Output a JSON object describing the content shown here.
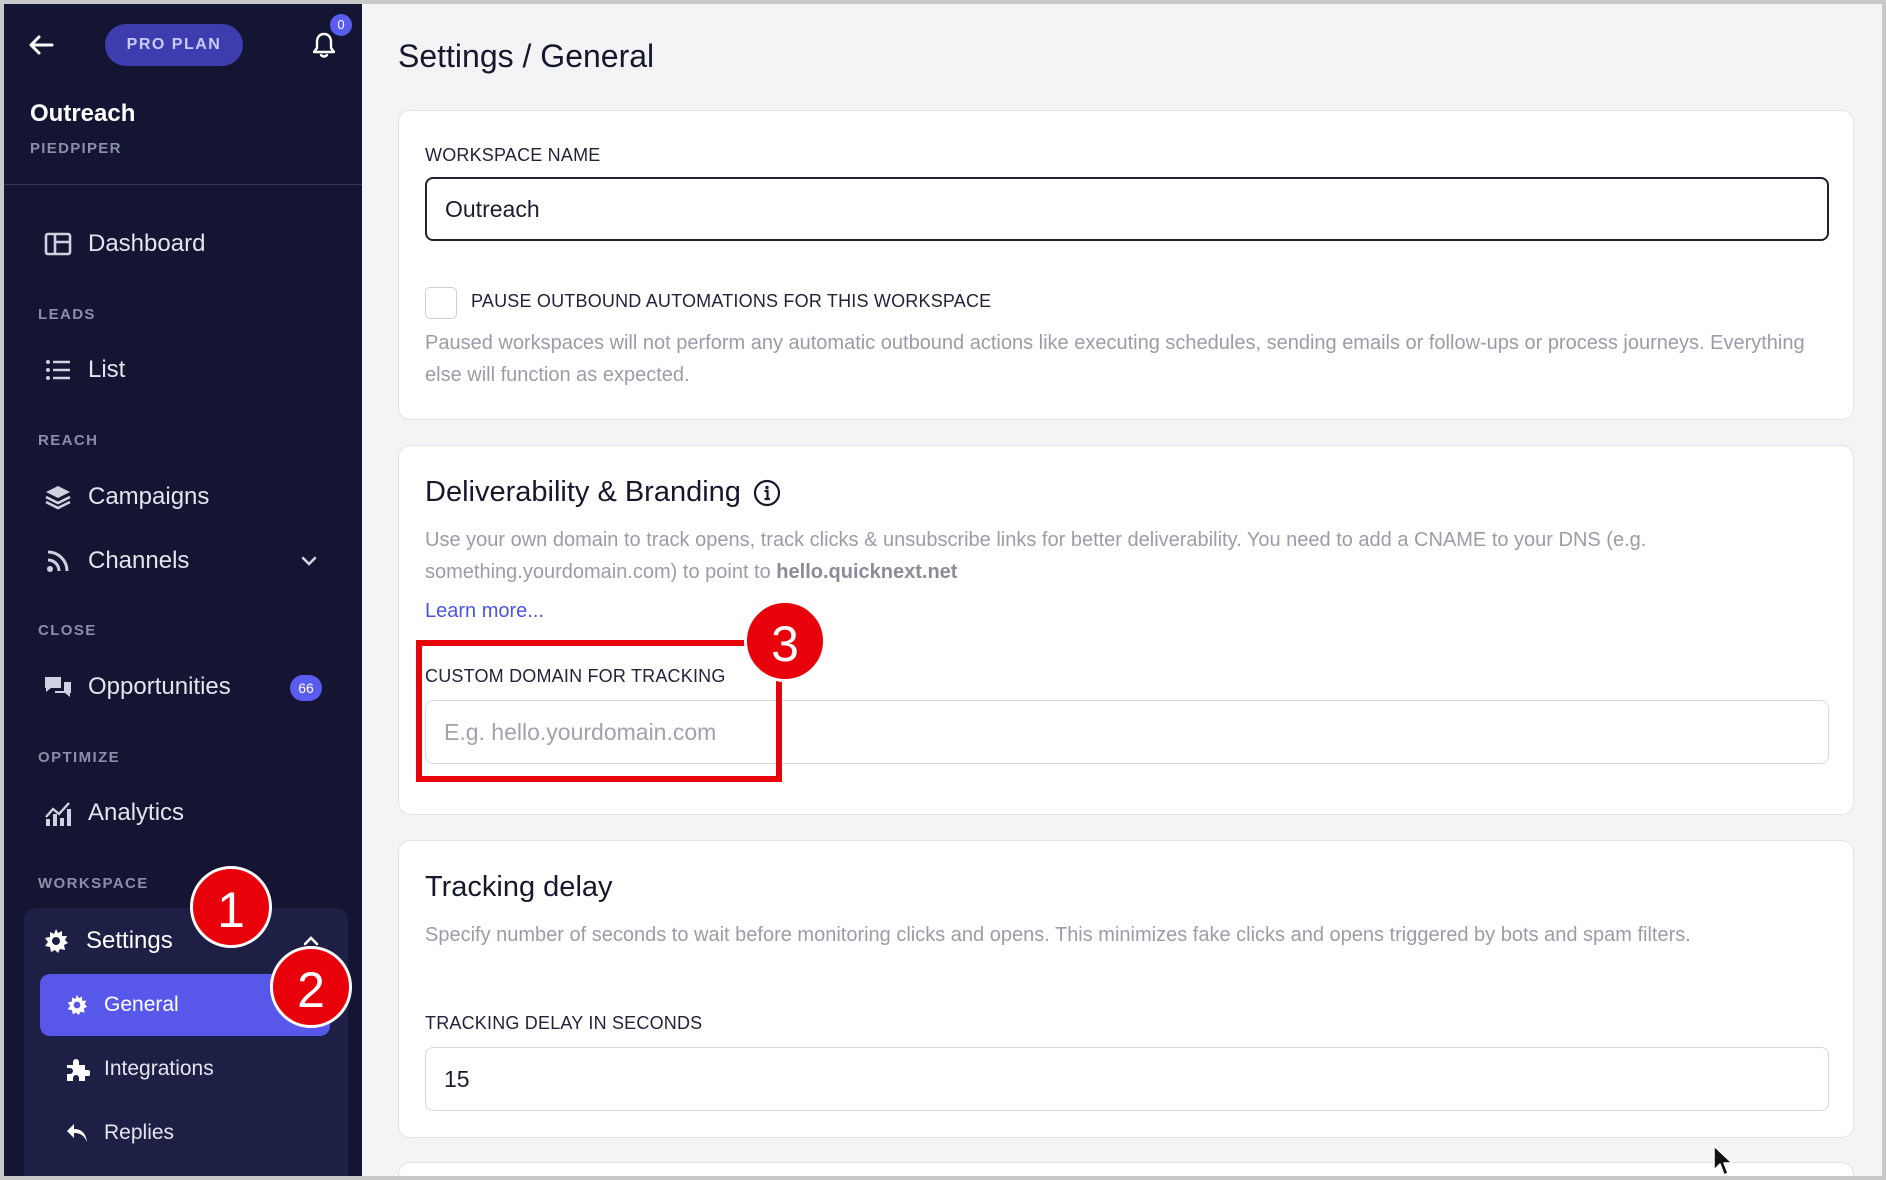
{
  "sidebar": {
    "plan_badge": "PRO PLAN",
    "notification_count": "0",
    "workspace_name": "Outreach",
    "workspace_org": "PIEDPIPER",
    "dashboard_label": "Dashboard",
    "sections": {
      "leads": "LEADS",
      "reach": "REACH",
      "close": "CLOSE",
      "optimize": "OPTIMIZE",
      "workspace": "WORKSPACE"
    },
    "list_label": "List",
    "campaigns_label": "Campaigns",
    "channels_label": "Channels",
    "opportunities_label": "Opportunities",
    "opportunities_count": "66",
    "analytics_label": "Analytics",
    "settings_label": "Settings",
    "settings_sub": {
      "general": "General",
      "integrations": "Integrations",
      "replies": "Replies"
    },
    "icons": {
      "back": "arrow-left-icon",
      "bell": "bell-icon",
      "dashboard": "dashboard-icon",
      "list": "list-icon",
      "campaigns": "layers-icon",
      "channels": "rss-icon",
      "opportunities": "chat-bubbles-icon",
      "analytics": "bar-chart-icon",
      "settings": "gear-icon",
      "integrations": "puzzle-icon",
      "replies": "reply-icon"
    }
  },
  "main": {
    "page_title": "Settings / General",
    "workspace_card": {
      "name_label": "WORKSPACE NAME",
      "name_value": "Outreach",
      "pause_label": "PAUSE OUTBOUND AUTOMATIONS FOR THIS WORKSPACE",
      "pause_checked": false,
      "pause_help": "Paused workspaces will not perform any automatic outbound actions like executing schedules, sending emails or follow-ups or process journeys. Everything else will function as expected."
    },
    "deliverability_card": {
      "title": "Deliverability & Branding",
      "help_prefix": "Use your own domain to track opens, track clicks & unsubscribe links for better deliverability. You need to add a CNAME to your DNS (e.g. something.yourdomain.com) to point to ",
      "help_domain": "hello.quicknext.net",
      "learn_more": "Learn more...",
      "custom_domain_label": "CUSTOM DOMAIN FOR TRACKING",
      "custom_domain_value": "",
      "custom_domain_placeholder": "E.g. hello.yourdomain.com"
    },
    "tracking_card": {
      "title": "Tracking delay",
      "help": "Specify number of seconds to wait before monitoring clicks and opens. This minimizes fake clicks and opens triggered by bots and spam filters.",
      "delay_label": "TRACKING DELAY IN SECONDS",
      "delay_value": "15"
    }
  },
  "annotations": {
    "marker_1": "1",
    "marker_2": "2",
    "marker_3": "3"
  },
  "colors": {
    "sidebar_bg": "#141532",
    "accent": "#5757ea",
    "annotation_red": "#e8000b",
    "link": "#4a56e2"
  }
}
